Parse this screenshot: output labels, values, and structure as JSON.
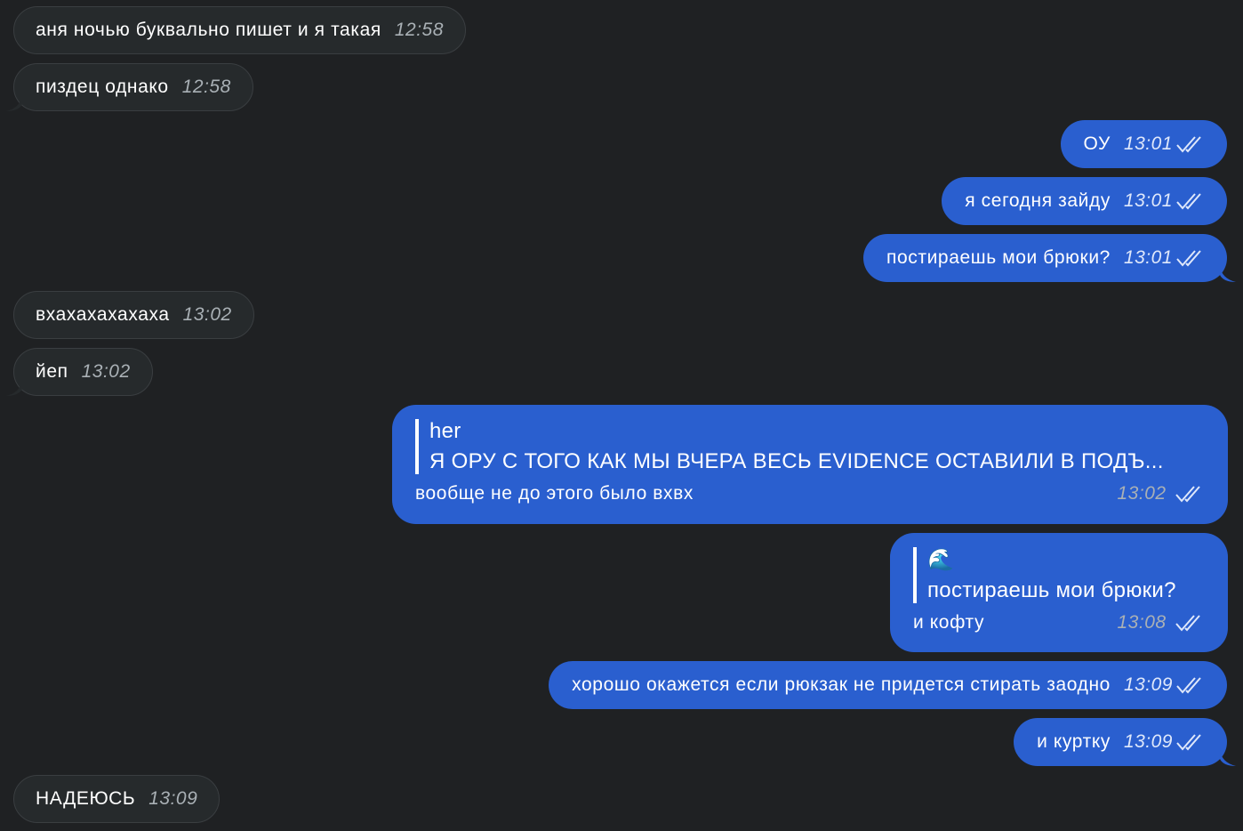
{
  "colors": {
    "background": "#1f2123",
    "incoming_bubble": "#262a2c",
    "outgoing_bubble": "#2a5fcf"
  },
  "messages": {
    "m1": {
      "text": "аня ночью буквально пишет и я такая",
      "time": "12:58"
    },
    "m2": {
      "text": "пиздец однако",
      "time": "12:58"
    },
    "m3": {
      "text": "ОУ",
      "time": "13:01"
    },
    "m4": {
      "text": "я сегодня зайду",
      "time": "13:01"
    },
    "m5": {
      "text": "постираешь мои брюки?",
      "time": "13:01"
    },
    "m6": {
      "text": "вхахахахахаха",
      "time": "13:02"
    },
    "m7": {
      "text": "йеп",
      "time": "13:02"
    },
    "m8": {
      "reply_author": "her",
      "reply_text": "Я ОРУ С ТОГО КАК МЫ ВЧЕРА ВЕСЬ EVIDENCE ОСТАВИЛИ В ПОДЪ...",
      "text": "вообще не до этого было вхвх",
      "time": "13:02"
    },
    "m9": {
      "reply_author": "🌊",
      "reply_text": "постираешь мои брюки?",
      "text": "и кофту",
      "time": "13:08"
    },
    "m10": {
      "text": "хорошо окажется если рюкзак не придется стирать заодно",
      "time": "13:09"
    },
    "m11": {
      "text": "и куртку",
      "time": "13:09"
    },
    "m12": {
      "text": "НАДЕЮСЬ",
      "time": "13:09"
    }
  },
  "icons": {
    "read_receipt": "double-check-icon",
    "reply_marker": "quote-bar"
  }
}
